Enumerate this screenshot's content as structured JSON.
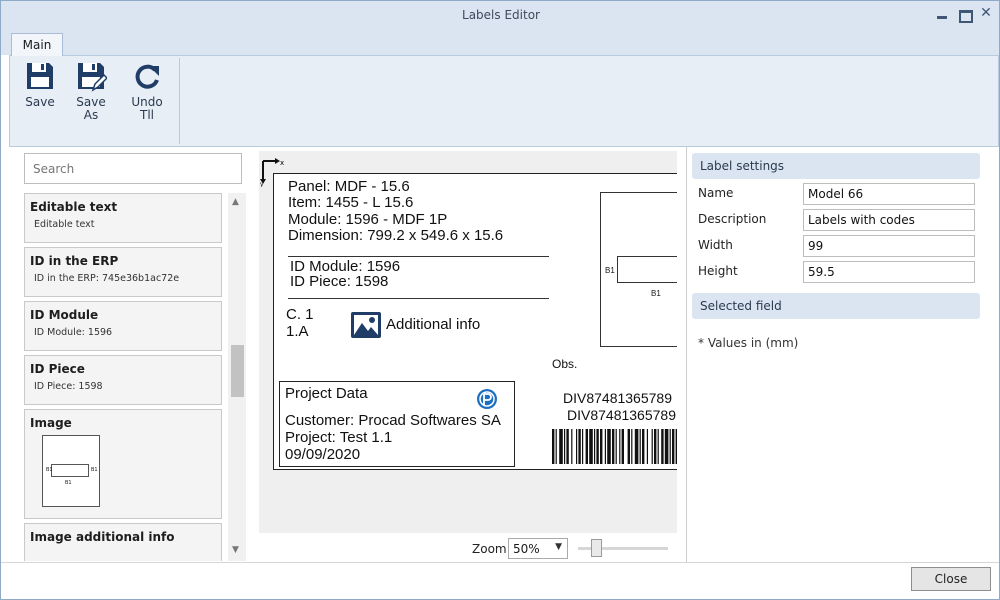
{
  "window": {
    "title": "Labels Editor",
    "close_glyph": "✕"
  },
  "ribbon": {
    "tab_main": "Main",
    "save": {
      "label": "Save",
      "icon": "floppy-disk-icon"
    },
    "save_as": {
      "label_line1": "Save",
      "label_line2": "As",
      "icon": "floppy-disk-pencil-icon"
    },
    "undo": {
      "label_line1": "Undo",
      "label_line2": "Tll",
      "icon": "undo-icon"
    }
  },
  "fields_panel": {
    "search_placeholder": "Search",
    "items": [
      {
        "title": "Editable text",
        "subtitle": "Editable text"
      },
      {
        "title": "ID in the ERP",
        "subtitle": "ID in the ERP: 745e36b1ac72e"
      },
      {
        "title": "ID Module",
        "subtitle": "ID Module: 1596"
      },
      {
        "title": "ID Piece",
        "subtitle": "ID Piece: 1598"
      },
      {
        "title": "Image",
        "thumb_a": "B1",
        "thumb_b": "B1",
        "thumb_c": "B1"
      },
      {
        "title": "Image additional info"
      }
    ]
  },
  "label_preview": {
    "axis_x": "x",
    "axis_y": "y",
    "panel": "Panel: MDF - 15.6",
    "item": "Item: 1455 - L 15.6",
    "module": "Module: 1596 - MDF 1P",
    "dimension": "Dimension: 799.2 x 549.6 x 15.6",
    "id_module": "ID Module: 1596",
    "id_piece": "ID Piece: 1598",
    "c_line1": "C. 1",
    "c_line2": "1.A",
    "additional_info": "Additional info",
    "image_b1_left": "B1",
    "image_b1_bottom": "B1",
    "obs": "Obs.",
    "project_title": "Project Data",
    "customer": "Customer: Procad Softwares SA",
    "project": "Project: Test 1.1",
    "date": "09/09/2020",
    "code1": "DIV87481365789",
    "code2": "DIV87481365789"
  },
  "zoom": {
    "label": "Zoom",
    "value": "50%",
    "slider_fraction": 0.15
  },
  "settings": {
    "label_settings_title": "Label settings",
    "name_label": "Name",
    "name_value": "Model 66",
    "description_label": "Description",
    "description_value": "Labels with codes",
    "width_label": "Width",
    "width_value": "99",
    "height_label": "Height",
    "height_value": "59.5",
    "selected_field_title": "Selected field",
    "units_note": "* Values in (mm)"
  },
  "footer": {
    "close_label": "Close"
  },
  "colors": {
    "accent": "#dbe5f1",
    "icon_blue": "#1f3d66",
    "logo_blue": "#1e6fbf"
  }
}
